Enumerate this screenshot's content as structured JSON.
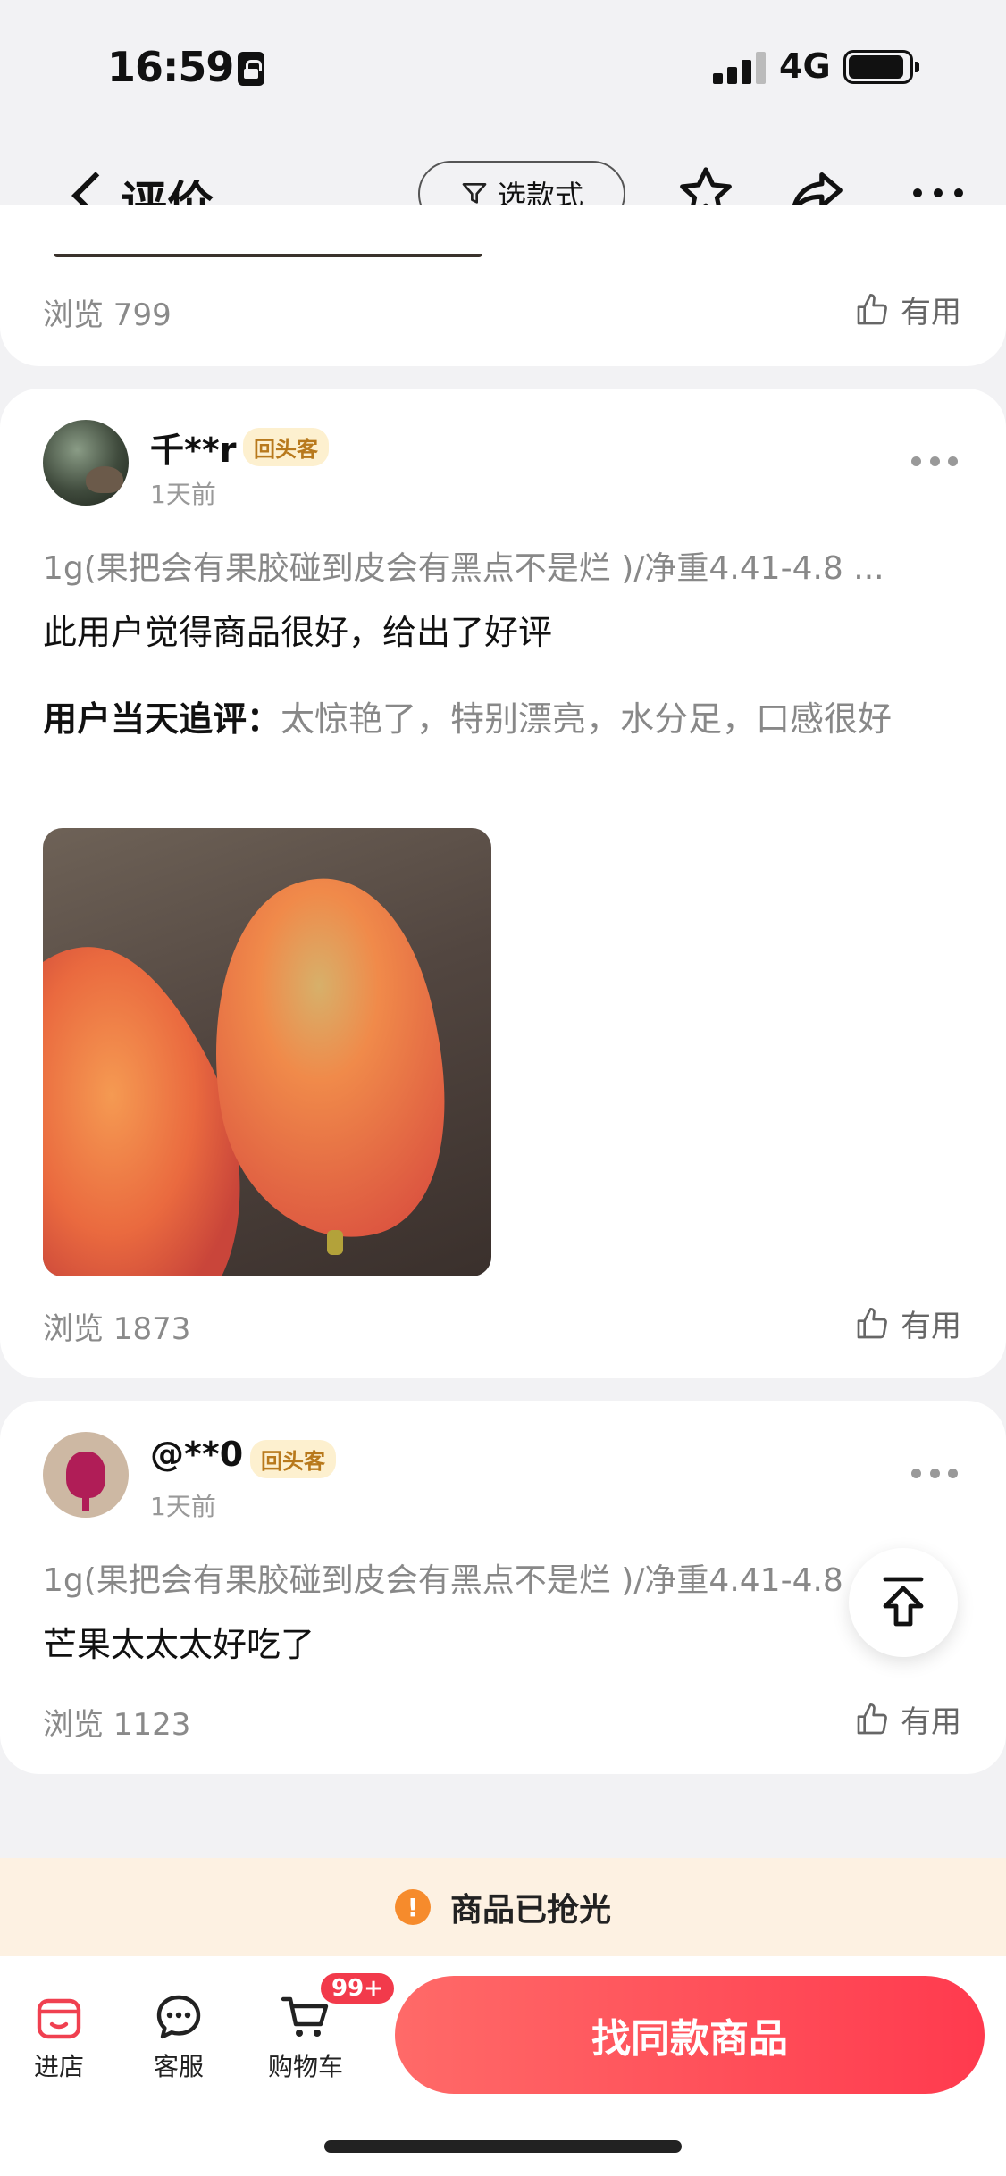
{
  "status_bar": {
    "time": "16:59",
    "network": "4G"
  },
  "nav": {
    "title": "评价",
    "filter_label": "选款式"
  },
  "reviews": [
    {
      "views": "浏览 799",
      "useful": "有用"
    },
    {
      "username": "千**r",
      "badge": "回头客",
      "time_ago": "1天前",
      "sku": "1g(果把会有果胶碰到皮会有黑点不是烂 )/净重4.41-4.8 ...",
      "text": "此用户觉得商品很好，给出了好评",
      "followup_label": "用户当天追评：",
      "followup_text": "太惊艳了，特别漂亮，水分足，口感很好",
      "views": "浏览 1873",
      "useful": "有用"
    },
    {
      "username": "@**0",
      "badge": "回头客",
      "time_ago": "1天前",
      "sku": "1g(果把会有果胶碰到皮会有黑点不是烂 )/净重4.41-4.8",
      "text": "芒果太太太好吃了",
      "views": "浏览 1123",
      "useful": "有用"
    }
  ],
  "soldout_text": "商品已抢光",
  "bottom_bar": {
    "store": "进店",
    "service": "客服",
    "cart": "购物车",
    "cart_badge": "99+",
    "cta": "找同款商品"
  },
  "colors": {
    "accent": "#ff3a4e",
    "badge_bg": "#fdf0cf",
    "badge_text": "#b8791c",
    "banner_bg": "#fdf1e2"
  }
}
